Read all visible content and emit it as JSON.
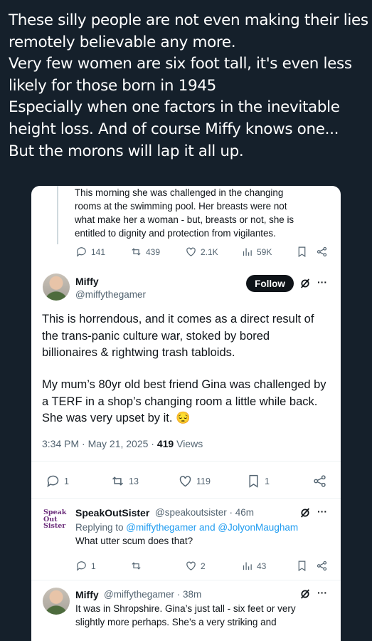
{
  "post": {
    "lines": [
      "These silly people are not even making their lies",
      "remotely believable any more.",
      "Very few women are six foot tall, it's even less",
      "likely for those born in 1945",
      "Especially when one factors in the inevitable",
      "height loss. And of course Miffy knows one...",
      "But the morons will lap it all up."
    ]
  },
  "quoted_tweet": {
    "lines": [
      "This morning she was challenged in the changing",
      "rooms at the swimming pool. Her breasts were not",
      "what make her a woman - but, breasts or not, she is",
      "entitled to dignity and protection from vigilantes."
    ],
    "replies": "141",
    "reposts": "439",
    "likes": "2.1K",
    "views": "59K"
  },
  "main_tweet": {
    "name": "Miffy",
    "handle": "@miffythegamer",
    "follow_label": "Follow",
    "more": "···",
    "paragraph1": [
      "This is horrendous, and it comes as a direct result of",
      "the trans-panic culture war, stoked by bored",
      "billionaires & rightwing trash tabloids."
    ],
    "paragraph2": [
      "My mum’s 80yr old best friend Gina was challenged by",
      "a TERF in a shop’s changing room a little while back.",
      "She was very upset by it. 😔"
    ],
    "timestamp": "3:34 PM · May 21, 2025 · ",
    "views_count": "419",
    "views_label": " Views",
    "replies": "1",
    "reposts": "13",
    "likes": "119",
    "bookmarks": "1"
  },
  "reply1": {
    "name": "SpeakOutSister",
    "handle_time": "@speakoutsister · 46m",
    "replying_prefix": "Replying to ",
    "mention1": "@miffythegamer",
    "and": " and ",
    "mention2": "@JolyonMaugham",
    "text": "What utter scum does that?",
    "replies": "1",
    "reposts": "",
    "likes": "2",
    "views": "43",
    "logo_line1": "Speak",
    "logo_line2": "Out",
    "logo_line3": "Sister"
  },
  "reply2": {
    "name": "Miffy",
    "handle_time": "@miffythegamer · 38m",
    "lines": [
      "It was in Shropshire. Gina’s just tall - six feet or very",
      "slightly more perhaps. She’s a very striking and"
    ]
  },
  "colors": {
    "background": "#15202b",
    "accent": "#1d9bf0",
    "text": "#0f1419",
    "muted": "#536471"
  }
}
